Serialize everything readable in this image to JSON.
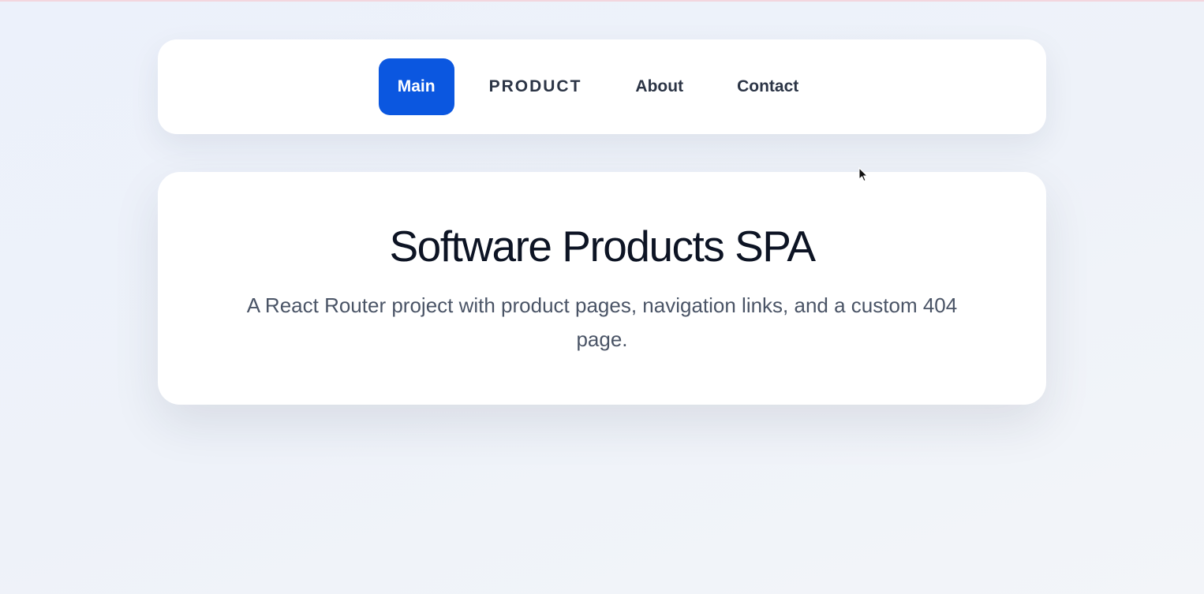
{
  "nav": {
    "items": [
      {
        "label": "Main",
        "active": true
      },
      {
        "label": "PRODUCT",
        "active": false
      },
      {
        "label": "About",
        "active": false
      },
      {
        "label": "Contact",
        "active": false
      }
    ]
  },
  "hero": {
    "title": "Software Products SPA",
    "description": "A React Router project with product pages, navigation links, and a custom 404 page."
  },
  "colors": {
    "accent": "#0b57e0",
    "text_dark": "#0d1424",
    "text_muted": "#4a5466",
    "nav_text": "#2b3445"
  }
}
